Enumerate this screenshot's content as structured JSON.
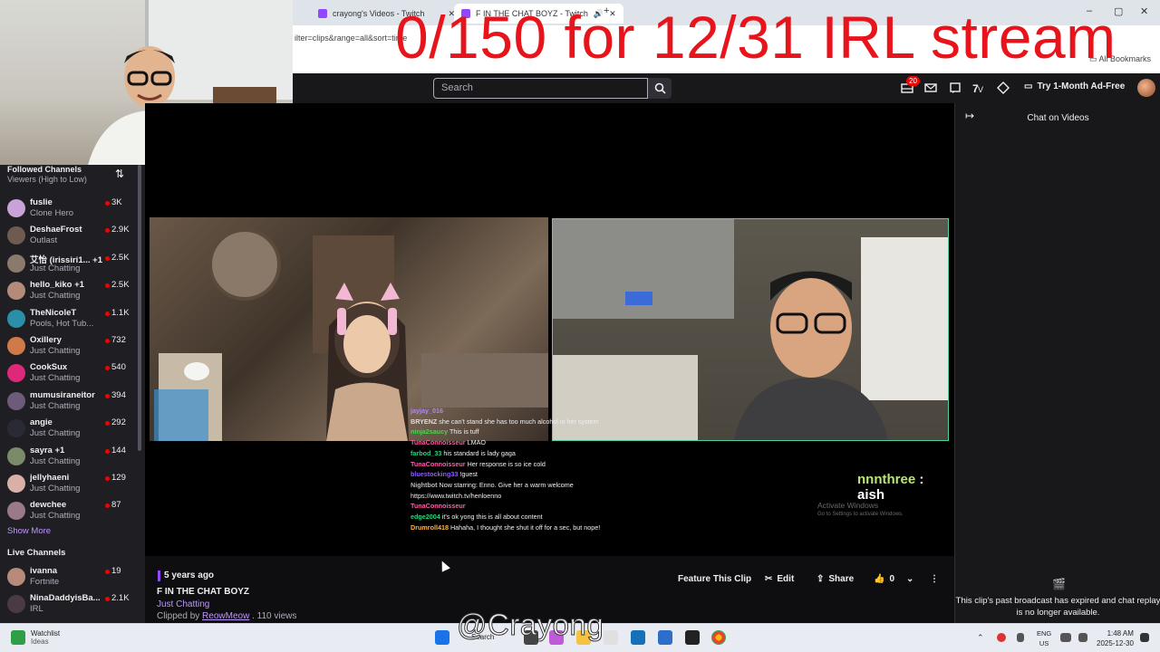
{
  "overlay_title": "0/150 for 12/31 IRL stream",
  "browser": {
    "tabs": [
      {
        "label": "crayong's Videos - Twitch"
      },
      {
        "label": "F IN THE CHAT BOYZ - Twitch"
      }
    ],
    "url_fragment": "ilter=clips&range=all&sort=time",
    "bookmarks_label": "All Bookmarks"
  },
  "topnav": {
    "search_placeholder": "Search",
    "notification_count": "20",
    "ad_free_label": "Try 1-Month Ad-Free"
  },
  "sidebar": {
    "header": "Followed Channels",
    "sort_label": "Viewers (High to Low)",
    "channels": [
      {
        "name": "fuslie",
        "game": "Clone Hero",
        "viewers": "3K",
        "avatar_color": "#c9a2d8"
      },
      {
        "name": "DeshaeFrost",
        "game": "Outlast",
        "viewers": "2.9K",
        "avatar_color": "#6e5a4e"
      },
      {
        "name": "艾怡 (irissiri1... +1",
        "game": "Just Chatting",
        "viewers": "2.5K",
        "avatar_color": "#8a7a6c"
      },
      {
        "name": "hello_kiko +1",
        "game": "Just Chatting",
        "viewers": "2.5K",
        "avatar_color": "#b48a79"
      },
      {
        "name": "TheNicoleT",
        "game": "Pools, Hot Tub...",
        "viewers": "1.1K",
        "avatar_color": "#2b8fa8"
      },
      {
        "name": "Oxillery",
        "game": "Just Chatting",
        "viewers": "732",
        "avatar_color": "#d07a4a"
      },
      {
        "name": "CookSux",
        "game": "Just Chatting",
        "viewers": "540",
        "avatar_color": "#e0287a"
      },
      {
        "name": "mumusiraneitor",
        "game": "Just Chatting",
        "viewers": "394",
        "avatar_color": "#6d5b7a"
      },
      {
        "name": "angie",
        "game": "Just Chatting",
        "viewers": "292",
        "avatar_color": "#2a2a34"
      },
      {
        "name": "sayra +1",
        "game": "Just Chatting",
        "viewers": "144",
        "avatar_color": "#7a8a6a"
      },
      {
        "name": "jellyhaeni",
        "game": "Just Chatting",
        "viewers": "129",
        "avatar_color": "#d8b0a8"
      },
      {
        "name": "dewchee",
        "game": "Just Chatting",
        "viewers": "87",
        "avatar_color": "#9a7a8a"
      }
    ],
    "show_more": "Show More",
    "live_header": "Live Channels",
    "live_channels": [
      {
        "name": "ivanna",
        "game": "Fortnite",
        "viewers": "19",
        "avatar_color": "#b88a7a"
      },
      {
        "name": "NinaDaddyisBa...",
        "game": "IRL",
        "viewers": "2.1K",
        "avatar_color": "#4a3a44"
      }
    ]
  },
  "player": {
    "chat_overlay": [
      {
        "user": "jayjay_016",
        "color": "#b284ff",
        "text": ""
      },
      {
        "user": "BRYENZ",
        "color": "#dddddd",
        "text": "she can't stand she has too much alcohol in her system"
      },
      {
        "user": "ninja2saucy",
        "color": "#4fd14f",
        "text": "This is tuff"
      },
      {
        "user": "TunaConnoisseur",
        "color": "#ff5ea8",
        "text": "LMAO"
      },
      {
        "user": "farbod_33",
        "color": "#2bd17e",
        "text": "his standard is lady gaga"
      },
      {
        "user": "TunaConnoisseur",
        "color": "#ff5ea8",
        "text": "Her response is so ice cold"
      },
      {
        "user": "bluestocking33",
        "color": "#8a5cff",
        "text": "!guest"
      },
      {
        "user": "Nightbot",
        "color": "#b8b8b8",
        "text": "Now starring: Enno. Give her a warm welcome https://www.twitch.tv/henloenno"
      },
      {
        "user": "TunaConnoisseur",
        "color": "#ff5ea8",
        "text": ""
      },
      {
        "user": "edge2004",
        "color": "#2bd17e",
        "text": "it's ok yong this is all about content"
      },
      {
        "user": "Drumroll418",
        "color": "#ffb347",
        "text": "Hahaha, I thought she shut it off for a sec, but nope!"
      }
    ],
    "highlight_user": "nnnthree",
    "highlight_text": ": aish",
    "activate_title": "Activate Windows",
    "activate_sub": "Go to Settings to activate Windows."
  },
  "info": {
    "time_ago": "5 years ago",
    "clip_title": "F IN THE CHAT BOYZ",
    "category": "Just Chatting",
    "clipped_by_prefix": "Clipped by",
    "clipper": "ReowMeow",
    "views": ". 110 views",
    "feature_label": "Feature This Clip",
    "edit_label": "Edit",
    "share_label": "Share",
    "like_count": "0"
  },
  "chat_panel": {
    "title": "Chat on Videos",
    "message": "This clip's past broadcast has expired and chat replay is no longer available."
  },
  "taskbar": {
    "watchlist": "Watchlist",
    "watchlist_sub": "Ideas",
    "search": "Search",
    "lang": "ENG",
    "region": "US",
    "time": "1:48 AM",
    "date": "2025-12-30"
  },
  "watermark": "@Crayong"
}
